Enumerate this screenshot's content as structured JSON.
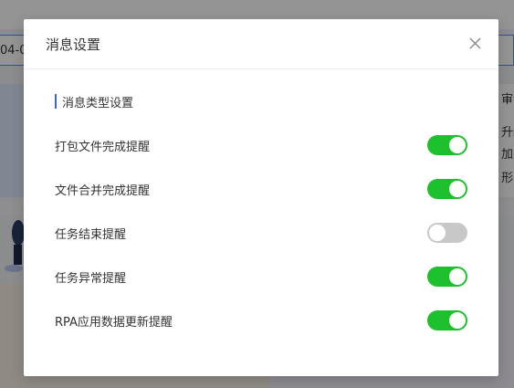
{
  "background": {
    "date_fragment": "04-0",
    "right_text_lines": [
      "审计功",
      "升级",
      "加上",
      "形，"
    ]
  },
  "modal": {
    "title": "消息设置",
    "close_icon": "close-icon",
    "section_title": "消息类型设置",
    "accent_color": "#3a62e0",
    "toggle_on_color": "#1dc12d",
    "toggle_off_color": "#c8c8c8",
    "settings": [
      {
        "label": "打包文件完成提醒",
        "enabled": true
      },
      {
        "label": "文件合并完成提醒",
        "enabled": true
      },
      {
        "label": "任务结束提醒",
        "enabled": false
      },
      {
        "label": "任务异常提醒",
        "enabled": true
      },
      {
        "label": "RPA应用数据更新提醒",
        "enabled": true
      }
    ]
  }
}
